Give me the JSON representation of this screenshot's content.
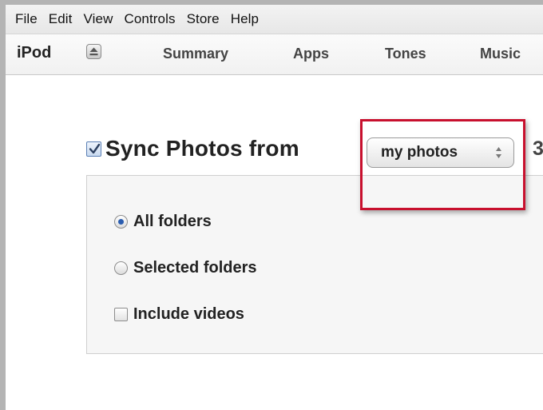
{
  "menubar": {
    "items": [
      "File",
      "Edit",
      "View",
      "Controls",
      "Store",
      "Help"
    ]
  },
  "navbar": {
    "device": "iPod",
    "eject_icon": "eject-icon",
    "tabs": [
      "Summary",
      "Apps",
      "Tones",
      "Music"
    ]
  },
  "sync": {
    "checked": true,
    "label": "Sync Photos from",
    "source": "my photos",
    "count_peek": "3"
  },
  "options": {
    "all_folders": "All folders",
    "selected_folders": "Selected folders",
    "include_videos": "Include videos",
    "selected": "All folders",
    "include_videos_checked": false
  },
  "colors": {
    "highlight": "#c8102e",
    "accent": "#2a5db0"
  }
}
